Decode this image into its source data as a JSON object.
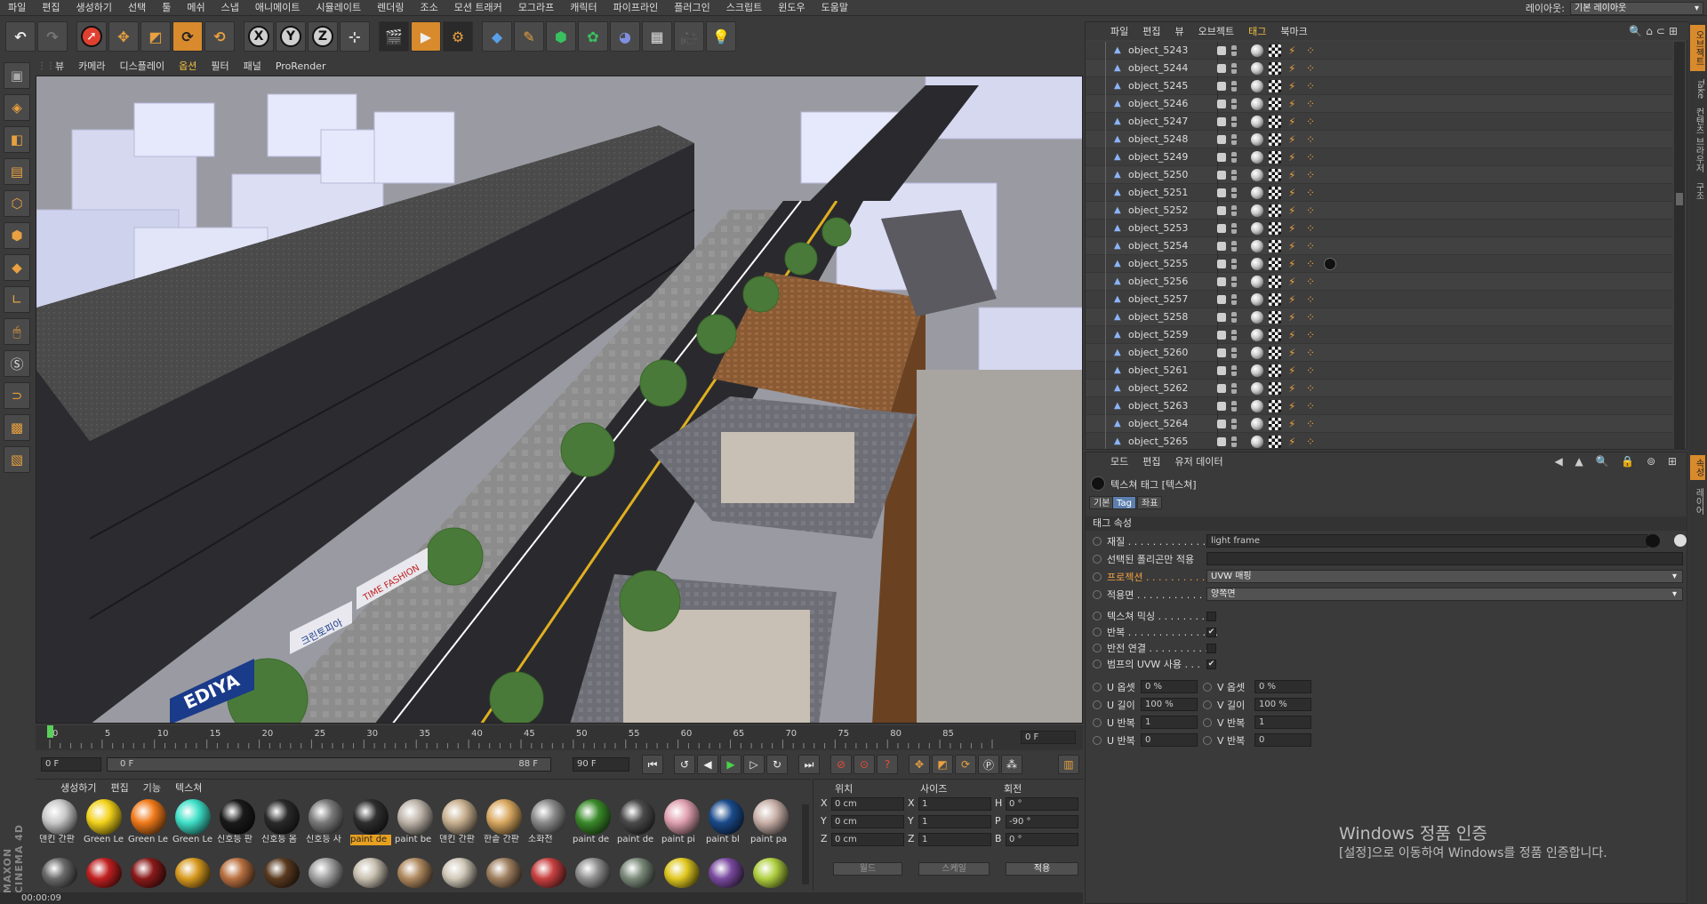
{
  "menubar": {
    "items": [
      "파일",
      "편집",
      "생성하기",
      "선택",
      "툴",
      "메쉬",
      "스냅",
      "애니메이트",
      "시뮬레이트",
      "렌더링",
      "조소",
      "모션 트래커",
      "모그라프",
      "캐릭터",
      "파이프라인",
      "플러그인",
      "스크립트",
      "윈도우",
      "도움말"
    ],
    "layout_label": "레이아웃:",
    "layout_value": "기본 레이아웃"
  },
  "toolbar": {
    "axis_x": "X",
    "axis_y": "Y",
    "axis_z": "Z"
  },
  "viewport": {
    "menu": [
      "뷰",
      "카메라",
      "디스플레이",
      "옵션",
      "필터",
      "패널",
      "ProRender"
    ],
    "active_menu": "옵션",
    "signs": {
      "cafe": "EDIYA",
      "shop1": "크린토피아",
      "shop2": "TIME FASHION"
    }
  },
  "timeline": {
    "ticks": [
      "0",
      "5",
      "10",
      "15",
      "20",
      "25",
      "30",
      "35",
      "40",
      "45",
      "50",
      "55",
      "60",
      "65",
      "70",
      "75",
      "80",
      "85"
    ],
    "current_frame": "0 F"
  },
  "transport": {
    "start": "0 F",
    "range_start": "0 F",
    "range_end": "88 F",
    "end": "90 F"
  },
  "materials": {
    "menu": [
      "생성하기",
      "편집",
      "기능",
      "텍스쳐"
    ],
    "row1": [
      {
        "label": "덴킨 간판",
        "color": "#c9c9c9"
      },
      {
        "label": "Green Le",
        "color": "#f2d21a"
      },
      {
        "label": "Green Le",
        "color": "#f07a1a"
      },
      {
        "label": "Green Le",
        "color": "#3fe0c8"
      },
      {
        "label": "신호등 판",
        "color": "#1a1a1a"
      },
      {
        "label": "신호등 몸",
        "color": "#2a2a2a"
      },
      {
        "label": "신호등 사",
        "color": "#7a7a7a"
      },
      {
        "label": "paint de",
        "color": "#2e2e2e",
        "selected": true
      },
      {
        "label": "paint be",
        "color": "#bdb3a8"
      },
      {
        "label": "덴킨 간판",
        "color": "#c8b090"
      },
      {
        "label": "한솥 간판",
        "color": "#d8a860"
      },
      {
        "label": "소화전",
        "color": "#8a8a8a"
      },
      {
        "label": "paint de",
        "color": "#3a8a2a"
      },
      {
        "label": "paint de",
        "color": "#4a4a4a"
      },
      {
        "label": "paint pi",
        "color": "#e0a0b0"
      },
      {
        "label": "paint bl",
        "color": "#1a4a8a"
      },
      {
        "label": "paint pa",
        "color": "#c8b0a8"
      }
    ],
    "row2_colors": [
      "#6a6a6a",
      "#c02020",
      "#8a1a1a",
      "#d89a20",
      "#b87040",
      "#5a3a20",
      "#a0a0a0",
      "#c8c0b0",
      "#b08a60",
      "#d0c8b8",
      "#a08060",
      "#c84040",
      "#909090",
      "#7a8a7a",
      "#e0c820",
      "#7a4aa0",
      "#b0d040"
    ]
  },
  "coordinates": {
    "headers": {
      "position": "위치",
      "size": "사이즈",
      "rotation": "회전"
    },
    "rows": [
      {
        "axis": "X",
        "pos": "0 cm",
        "saxis": "X",
        "size": "1",
        "raxis": "H",
        "rot": "0 °"
      },
      {
        "axis": "Y",
        "pos": "0 cm",
        "saxis": "Y",
        "size": "1",
        "raxis": "P",
        "rot": "-90 °"
      },
      {
        "axis": "Z",
        "pos": "0 cm",
        "saxis": "Z",
        "size": "1",
        "raxis": "B",
        "rot": "0 °"
      }
    ],
    "world_btn": "월드",
    "scale_btn": "스케일",
    "apply_btn": "적용"
  },
  "status": {
    "time": "00:00:09"
  },
  "object_manager": {
    "menu": [
      "파일",
      "편집",
      "뷰",
      "오브젝트",
      "태그",
      "북마크"
    ],
    "active_menu": "태그",
    "objects": [
      "object_5243",
      "object_5244",
      "object_5245",
      "object_5246",
      "object_5247",
      "object_5248",
      "object_5249",
      "object_5250",
      "object_5251",
      "object_5252",
      "object_5253",
      "object_5254",
      "object_5255",
      "object_5256",
      "object_5257",
      "object_5258",
      "object_5259",
      "object_5260",
      "object_5261",
      "object_5262",
      "object_5263",
      "object_5264",
      "object_5265"
    ]
  },
  "attribute_manager": {
    "menu": [
      "모드",
      "편집",
      "유저 데이터"
    ],
    "title": "텍스쳐 태그 [텍스쳐]",
    "subtabs": [
      "기본",
      "Tag",
      "좌표"
    ],
    "active_subtab": "Tag",
    "section": "태그 속성",
    "material_label": "재질 . . . . . . . . . . . . . . .",
    "material_value": "light frame",
    "selection_label": "선택된 폴리곤만 적용",
    "projection_label": "프로젝션 . . . . . . . . . . . . .",
    "projection_value": "UVW 매핑",
    "side_label": "적용면 . . . . . . . . . . . . . .",
    "side_value": "양쪽면",
    "mix_label": "텍스쳐 믹싱 . . . . . . . .",
    "tile_label": "반복 . . . . . . . . . . . . . . .",
    "seamless_label": "반전 연결 . . . . . . . . . .",
    "bump_label": "범프의 UVW 사용 . . .",
    "u_offset_label": "U 옵셋",
    "u_offset": "0 %",
    "v_offset_label": "V 옵셋",
    "v_offset": "0 %",
    "u_len_label": "U 길이",
    "u_len": "100 %",
    "v_len_label": "V 길이",
    "v_len": "100 %",
    "u_tile_label": "U 반복",
    "u_tile": "1",
    "v_tile_label": "V 반복",
    "v_tile": "1",
    "u_rep_label": "U 반복",
    "u_rep": "0",
    "v_rep_label": "V 반복",
    "v_rep": "0"
  },
  "right_tabs": {
    "top": [
      "오브젝트",
      "Take",
      "컨텐츠 브라우저",
      "구조"
    ],
    "bottom": [
      "속성",
      "레이어"
    ]
  },
  "watermark": {
    "line1": "Windows 정품 인증",
    "line2": "[설정]으로 이동하여 Windows를 정품 인증합니다."
  }
}
